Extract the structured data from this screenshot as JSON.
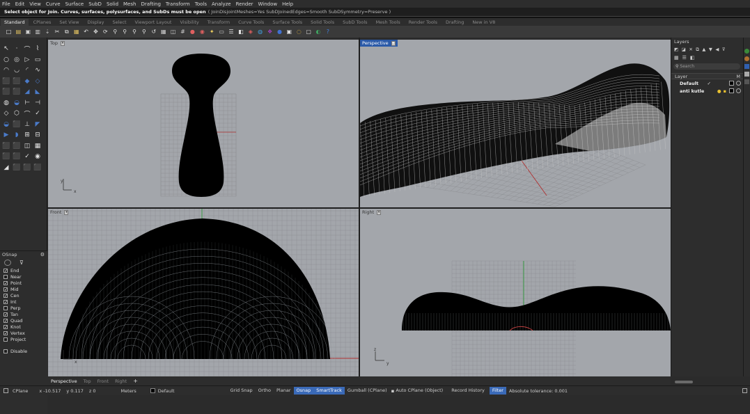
{
  "menu": [
    "File",
    "Edit",
    "View",
    "Curve",
    "Surface",
    "SubD",
    "Solid",
    "Mesh",
    "Drafting",
    "Transform",
    "Tools",
    "Analyze",
    "Render",
    "Window",
    "Help"
  ],
  "command": {
    "prompt": "Select object for Join. Curves, surfaces, polysurfaces, and SubDs must be open",
    "options": "( JoinDisjointMeshes=Yes  SubDJoinedEdges=Smooth  SubDSymmetry=Preserve )"
  },
  "tabs": [
    "Standard",
    "CPlanes",
    "Set View",
    "Display",
    "Select",
    "Viewport Layout",
    "Visibility",
    "Transform",
    "Curve Tools",
    "Surface Tools",
    "Solid Tools",
    "SubD Tools",
    "Mesh Tools",
    "Render Tools",
    "Drafting",
    "New in V8"
  ],
  "toolbar_icons": [
    "new-icon",
    "open-icon",
    "save-icon",
    "print-icon",
    "import-icon",
    "cut-icon",
    "copy-icon",
    "paste-icon",
    "undo-icon",
    "pan-icon",
    "rotate-view-icon",
    "zoom-icon",
    "zoom-window-icon",
    "zoom-extents-icon",
    "zoom-selected-icon",
    "undo-view-icon",
    "four-views-icon",
    "named-views-icon",
    "grid-icon",
    "shaded-icon",
    "rendered-icon",
    "lights-icon",
    "layer-icon",
    "properties-icon",
    "object-properties-icon",
    "materials-icon",
    "render-icon",
    "help-icon",
    "sphere-icon",
    "snapshot-icon",
    "hide-icon",
    "lock-icon",
    "globe-icon",
    "help-circle-icon"
  ],
  "toolbar_glyphs": [
    "□",
    "▤",
    "▣",
    "▥",
    "⇣",
    "✂",
    "⧉",
    "▦",
    "↶",
    "✥",
    "⟳",
    "⚲",
    "⚲",
    "⚲",
    "⚲",
    "↺",
    "▦",
    "◫",
    "#",
    "●",
    "◉",
    "✦",
    "▭",
    "☰",
    "◧",
    "◈",
    "◍",
    "❖",
    "●",
    "▣",
    "◌",
    "▢",
    "◐",
    "?"
  ],
  "left_tools": [
    "↖",
    "·",
    "⌒",
    "⌇",
    "○",
    "◎",
    "▷",
    "▭",
    "◠",
    "◡",
    "◜",
    "∿",
    "⬛",
    "⬛",
    "◆",
    "◇",
    "⬛",
    "⬛",
    "◢",
    "◣",
    "◍",
    "◒",
    "⊢",
    "⊣",
    "◇",
    "⬡",
    "⌒",
    "✓",
    "◒",
    "⬛",
    "⊥",
    "◤",
    "▶",
    "◗",
    "⊞",
    "⊟",
    "⬛",
    "⬛",
    "◫",
    "▦",
    "⬛",
    "⬛",
    "✓",
    "◉",
    "◢",
    "⬛",
    "⬛",
    "⬛"
  ],
  "viewports": {
    "top": {
      "title": "Top"
    },
    "perspective": {
      "title": "Perspective"
    },
    "front": {
      "title": "Front"
    },
    "right": {
      "title": "Right"
    }
  },
  "axis_labels": {
    "x": "x",
    "y": "y",
    "z": "z"
  },
  "osnap": {
    "title": "OSnap",
    "items": [
      {
        "label": "End",
        "checked": true
      },
      {
        "label": "Near",
        "checked": false
      },
      {
        "label": "Point",
        "checked": true
      },
      {
        "label": "Mid",
        "checked": true
      },
      {
        "label": "Cen",
        "checked": true
      },
      {
        "label": "Int",
        "checked": true
      },
      {
        "label": "Perp",
        "checked": false
      },
      {
        "label": "Tan",
        "checked": true
      },
      {
        "label": "Quad",
        "checked": true
      },
      {
        "label": "Knot",
        "checked": true
      },
      {
        "label": "Vertex",
        "checked": true
      },
      {
        "label": "Project",
        "checked": false
      }
    ],
    "disable": "Disable"
  },
  "layers": {
    "title": "Layers",
    "search_placeholder": "Search",
    "header": {
      "layer": "Layer",
      "material": "M"
    },
    "rows": [
      {
        "name": "Default",
        "current": true,
        "color": "#000000"
      },
      {
        "name": "anti kutle",
        "current": false,
        "color": "#000000"
      }
    ]
  },
  "viewport_tabs": [
    "Perspective",
    "Top",
    "Front",
    "Right",
    "+"
  ],
  "status": {
    "cplane": "CPlane",
    "x": "x -10.517",
    "y": "y 0.117",
    "z": "z 0",
    "units": "Meters",
    "layer": "Default",
    "grid_snap": "Grid Snap",
    "ortho": "Ortho",
    "planar": "Planar",
    "osnap": "Osnap",
    "smarttrack": "SmartTrack",
    "gumball": "Gumball (CPlane)",
    "auto_cplane": "Auto CPlane (Object)",
    "record_history": "Record History",
    "filter": "Filter",
    "tolerance": "Absolute tolerance: 0.001"
  },
  "colors": {
    "accent": "#3a6ab8",
    "viewport_bg": "#a3a6ab",
    "active_title": "#2b5aa8"
  }
}
